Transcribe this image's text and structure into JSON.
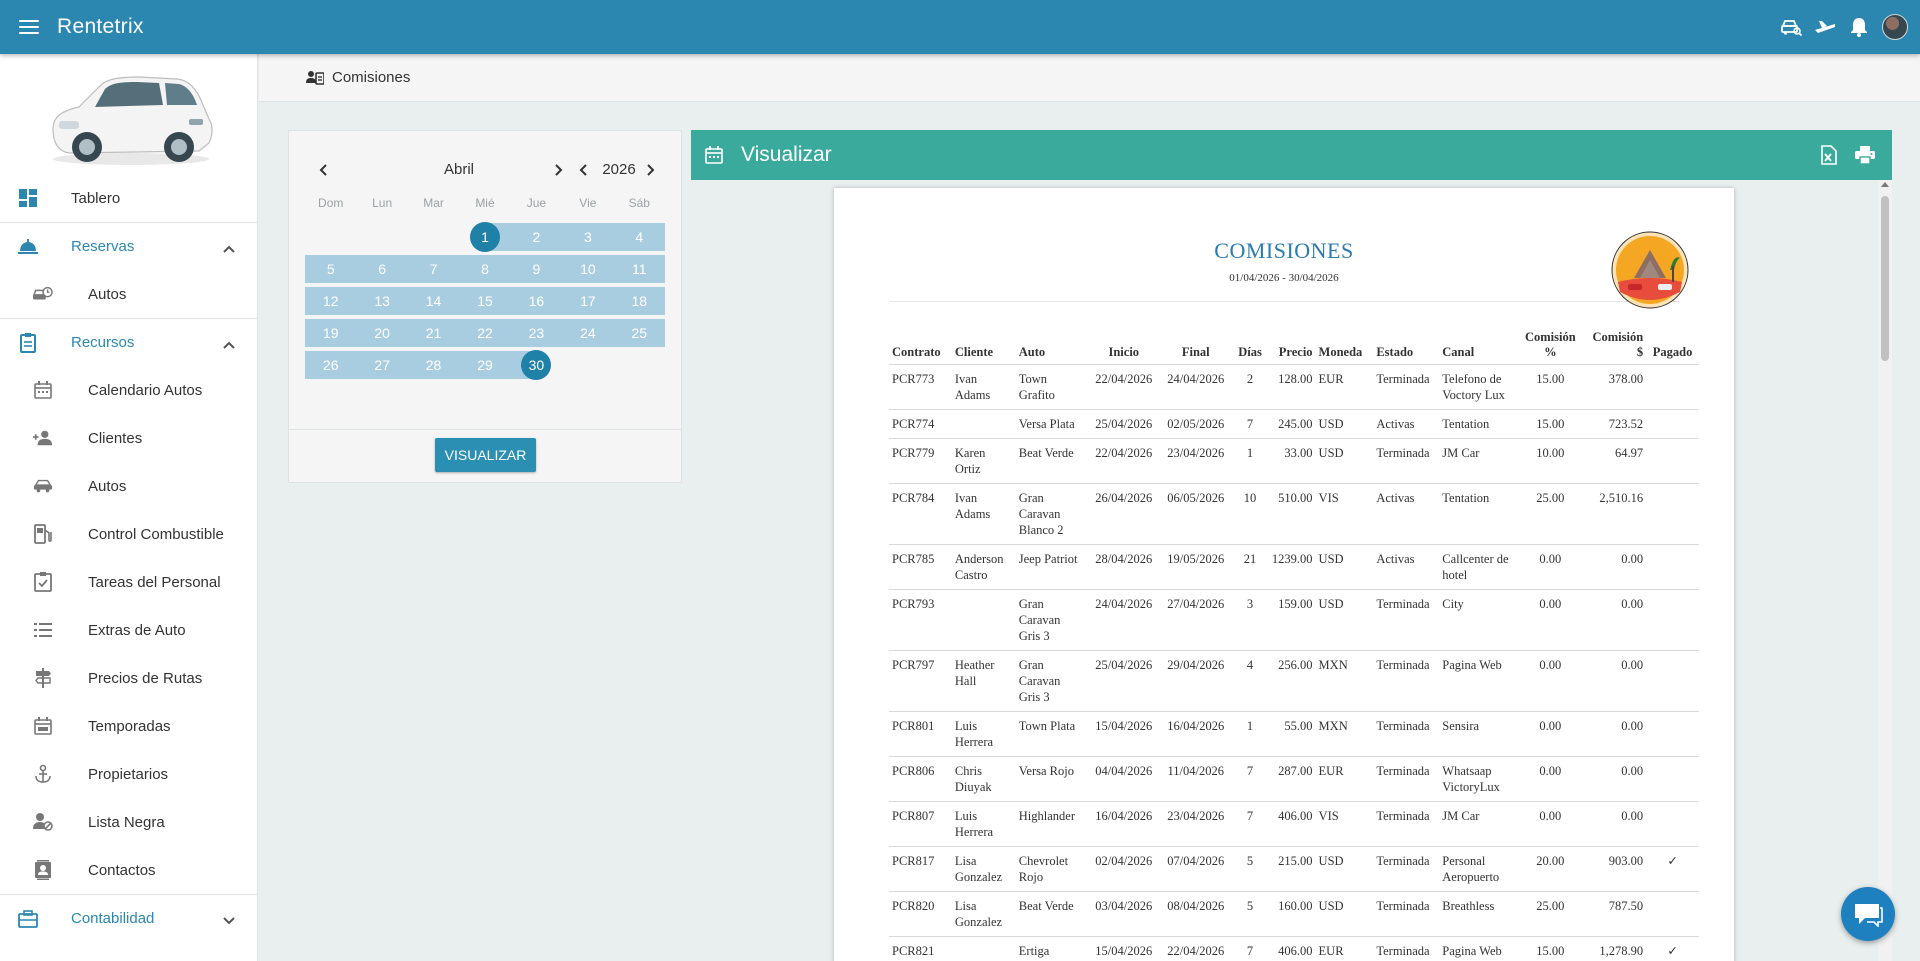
{
  "app": {
    "title": "Rentetrix"
  },
  "sidebar": {
    "items": [
      {
        "label": "Tablero"
      },
      {
        "label": "Reservas"
      },
      {
        "label": "Autos"
      },
      {
        "label": "Recursos"
      },
      {
        "label": "Calendario Autos"
      },
      {
        "label": "Clientes"
      },
      {
        "label": "Autos"
      },
      {
        "label": "Control Combustible"
      },
      {
        "label": "Tareas del Personal"
      },
      {
        "label": "Extras de Auto"
      },
      {
        "label": "Precios de Rutas"
      },
      {
        "label": "Temporadas"
      },
      {
        "label": "Propietarios"
      },
      {
        "label": "Lista Negra"
      },
      {
        "label": "Contactos"
      },
      {
        "label": "Contabilidad"
      }
    ]
  },
  "breadcrumb": {
    "label": "Comisiones"
  },
  "calendar": {
    "month": "Abril",
    "year": "2026",
    "weekdays": [
      "Dom",
      "Lun",
      "Mar",
      "Mié",
      "Jue",
      "Vie",
      "Sáb"
    ],
    "days": [
      "1",
      "2",
      "3",
      "4",
      "5",
      "6",
      "7",
      "8",
      "9",
      "10",
      "11",
      "12",
      "13",
      "14",
      "15",
      "16",
      "17",
      "18",
      "19",
      "20",
      "21",
      "22",
      "23",
      "24",
      "25",
      "26",
      "27",
      "28",
      "29",
      "30"
    ],
    "button_label": "VISUALIZAR"
  },
  "report": {
    "header_title": "Visualizar",
    "title": "COMISIONES",
    "date_range": "01/04/2026 - 30/04/2026",
    "columns": [
      "Contrato",
      "Cliente",
      "Auto",
      "Inicio",
      "Final",
      "Días",
      "Precio",
      "Moneda",
      "Estado",
      "Canal",
      "Comisión %",
      "Comisión $",
      "Pagado"
    ],
    "rows": [
      [
        "PCR773",
        "Ivan Adams",
        "Town Grafito",
        "22/04/2026",
        "24/04/2026",
        "2",
        "128.00",
        "EUR",
        "Terminada",
        "Telefono de Voctory Lux",
        "15.00",
        "378.00",
        ""
      ],
      [
        "PCR774",
        "",
        "Versa Plata",
        "25/04/2026",
        "02/05/2026",
        "7",
        "245.00",
        "USD",
        "Activas",
        "Tentation",
        "15.00",
        "723.52",
        ""
      ],
      [
        "PCR779",
        "Karen Ortiz",
        "Beat Verde",
        "22/04/2026",
        "23/04/2026",
        "1",
        "33.00",
        "USD",
        "Terminada",
        "JM Car",
        "10.00",
        "64.97",
        ""
      ],
      [
        "PCR784",
        "Ivan Adams",
        "Gran Caravan Blanco 2",
        "26/04/2026",
        "06/05/2026",
        "10",
        "510.00",
        "VIS",
        "Activas",
        "Tentation",
        "25.00",
        "2,510.16",
        ""
      ],
      [
        "PCR785",
        "Anderson Castro",
        "Jeep Patriot",
        "28/04/2026",
        "19/05/2026",
        "21",
        "1239.00",
        "USD",
        "Activas",
        "Callcenter de hotel",
        "0.00",
        "0.00",
        ""
      ],
      [
        "PCR793",
        "",
        "Gran Caravan Gris 3",
        "24/04/2026",
        "27/04/2026",
        "3",
        "159.00",
        "USD",
        "Terminada",
        "City",
        "0.00",
        "0.00",
        ""
      ],
      [
        "PCR797",
        "Heather Hall",
        "Gran Caravan Gris 3",
        "25/04/2026",
        "29/04/2026",
        "4",
        "256.00",
        "MXN",
        "Terminada",
        "Pagina Web",
        "0.00",
        "0.00",
        ""
      ],
      [
        "PCR801",
        "Luis Herrera",
        "Town Plata",
        "15/04/2026",
        "16/04/2026",
        "1",
        "55.00",
        "MXN",
        "Terminada",
        "Sensira",
        "0.00",
        "0.00",
        ""
      ],
      [
        "PCR806",
        "Chris Diuyak",
        "Versa Rojo",
        "04/04/2026",
        "11/04/2026",
        "7",
        "287.00",
        "EUR",
        "Terminada",
        "Whatsaap VictoryLux",
        "0.00",
        "0.00",
        ""
      ],
      [
        "PCR807",
        "Luis Herrera",
        "Highlander",
        "16/04/2026",
        "23/04/2026",
        "7",
        "406.00",
        "VIS",
        "Terminada",
        "JM Car",
        "0.00",
        "0.00",
        ""
      ],
      [
        "PCR817",
        "Lisa Gonzalez",
        "Chevrolet Rojo",
        "02/04/2026",
        "07/04/2026",
        "5",
        "215.00",
        "USD",
        "Terminada",
        "Personal Aeropuerto",
        "20.00",
        "903.00",
        "✓"
      ],
      [
        "PCR820",
        "Lisa Gonzalez",
        "Beat Verde",
        "03/04/2026",
        "08/04/2026",
        "5",
        "160.00",
        "USD",
        "Terminada",
        "Breathless",
        "25.00",
        "787.50",
        ""
      ],
      [
        "PCR821",
        "",
        "Ertiga",
        "15/04/2026",
        "22/04/2026",
        "7",
        "406.00",
        "EUR",
        "Terminada",
        "Pagina Web",
        "15.00",
        "1,278.90",
        "✓"
      ]
    ]
  },
  "colors": {
    "topbar": "#2b87b0",
    "accent": "#3aaa9c",
    "selected_day": "#1f80a8",
    "range": "#a9cde0",
    "report_title": "#2b7bb0"
  },
  "icons": [
    "menu-icon",
    "car-search-icon",
    "plane-icon",
    "bell-icon",
    "avatar",
    "dashboard-icon",
    "reservation-icon",
    "car-clock-icon",
    "clipboard-icon",
    "calendar-icon",
    "user-group-icon",
    "car-icon",
    "fuel-icon",
    "task-icon",
    "list-icon",
    "signpost-icon",
    "calendar-range-icon",
    "anchor-icon",
    "user-block-icon",
    "contacts-icon",
    "accounting-icon",
    "excel-icon",
    "print-icon",
    "chat-icon"
  ]
}
